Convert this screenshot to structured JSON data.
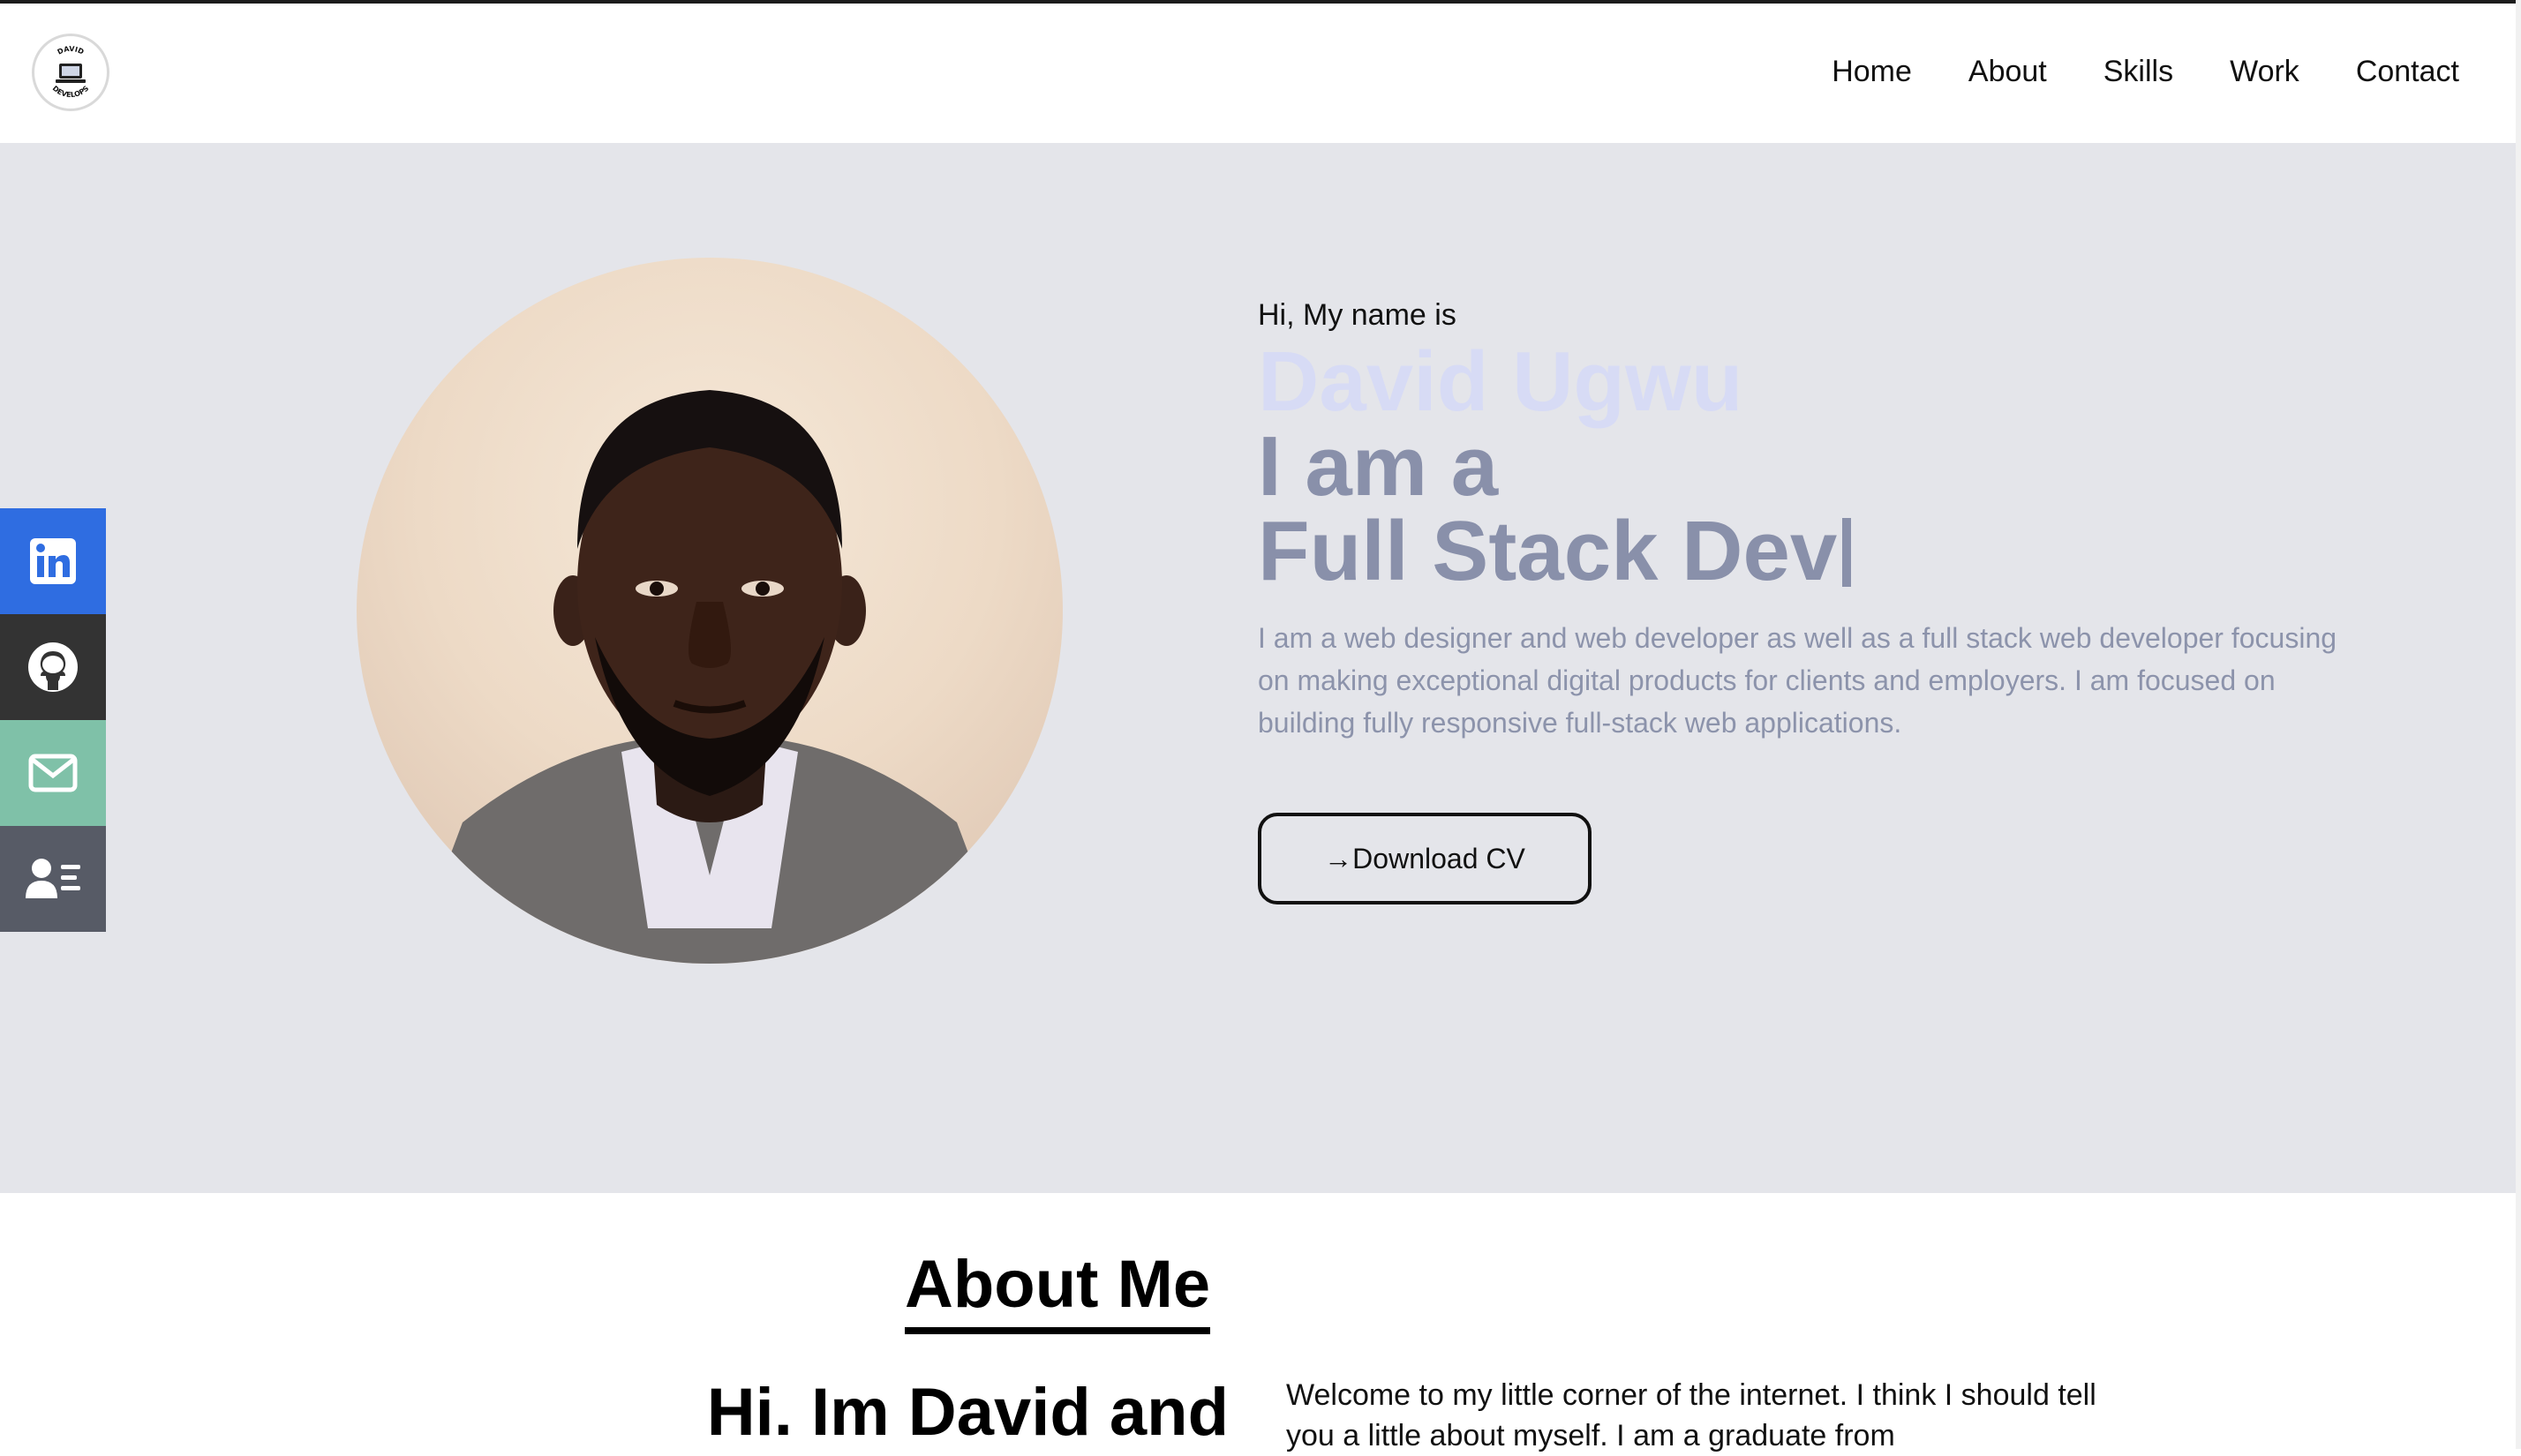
{
  "header": {
    "logo_top_text": "DAVID",
    "logo_bottom_text": "DEVELOPS",
    "nav": [
      "Home",
      "About",
      "Skills",
      "Work",
      "Contact"
    ]
  },
  "hero": {
    "greeting": "Hi, My name is",
    "name": "David Ugwu",
    "role_line1": "I am a",
    "role_line2": "Full Stack Dev",
    "intro": "I am a web designer and web developer as well as a full stack web developer focusing on making exceptional digital products for clients and employers. I am focused on building fully responsive full-stack web applications.",
    "cv_button": "→Download CV"
  },
  "social": {
    "items": [
      {
        "icon": "linkedin-icon",
        "color": "#2f6de1"
      },
      {
        "icon": "github-icon",
        "color": "#333333"
      },
      {
        "icon": "mail-icon",
        "color": "#7fc1a8"
      },
      {
        "icon": "resume-icon",
        "color": "#575b66"
      }
    ]
  },
  "about": {
    "title": "About Me",
    "heading": "Hi. Im David and",
    "body": "Welcome to my little corner of the internet. I think I should tell you a little about myself. I am a graduate from"
  },
  "colors": {
    "hero_bg": "#e4e5ea",
    "name_color": "#d7dbf5",
    "role_color": "#8990aa",
    "intro_color": "#8c93ab"
  }
}
